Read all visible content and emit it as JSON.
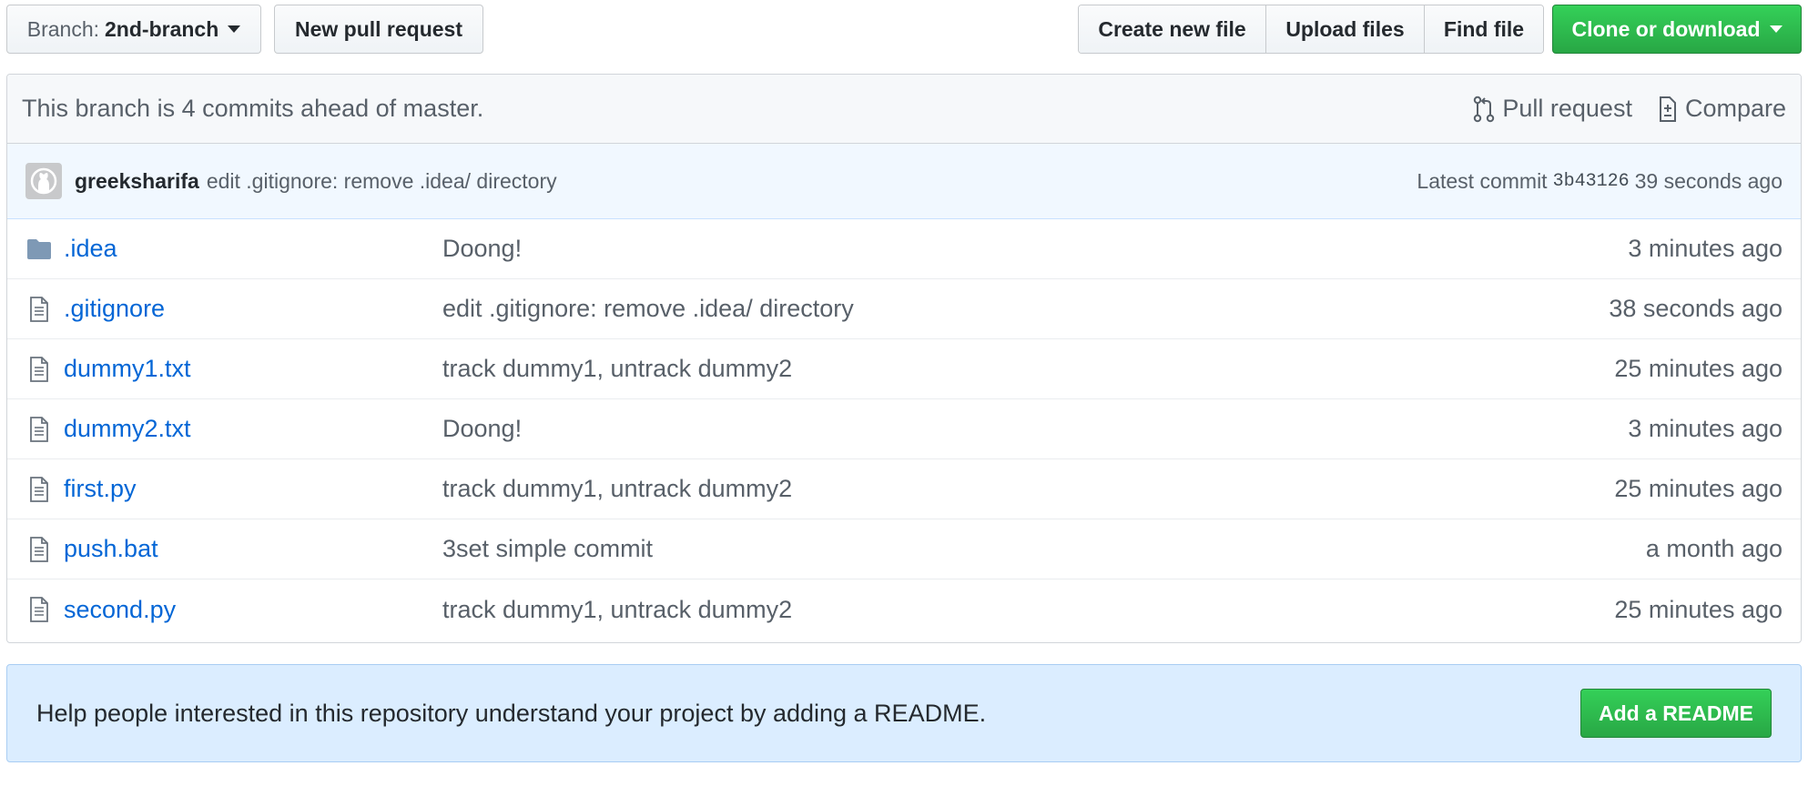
{
  "toolbar": {
    "branch_prefix": "Branch:",
    "branch_name": "2nd-branch",
    "new_pull_request": "New pull request",
    "create_new_file": "Create new file",
    "upload_files": "Upload files",
    "find_file": "Find file",
    "clone_or_download": "Clone or download"
  },
  "branch_info": {
    "text": "This branch is 4 commits ahead of master.",
    "pull_request": "Pull request",
    "compare": "Compare"
  },
  "latest_commit": {
    "author": "greeksharifa",
    "message": "edit .gitignore: remove .idea/ directory",
    "label": "Latest commit",
    "sha": "3b43126",
    "age": "39 seconds ago"
  },
  "files": [
    {
      "name": ".idea",
      "type": "folder",
      "message": "Doong!",
      "age": "3 minutes ago"
    },
    {
      "name": ".gitignore",
      "type": "file",
      "message": "edit .gitignore: remove .idea/ directory",
      "age": "38 seconds ago"
    },
    {
      "name": "dummy1.txt",
      "type": "file",
      "message": "track dummy1, untrack dummy2",
      "age": "25 minutes ago"
    },
    {
      "name": "dummy2.txt",
      "type": "file",
      "message": "Doong!",
      "age": "3 minutes ago"
    },
    {
      "name": "first.py",
      "type": "file",
      "message": "track dummy1, untrack dummy2",
      "age": "25 minutes ago"
    },
    {
      "name": "push.bat",
      "type": "file",
      "message": "3set simple commit",
      "age": "a month ago"
    },
    {
      "name": "second.py",
      "type": "file",
      "message": "track dummy1, untrack dummy2",
      "age": "25 minutes ago"
    }
  ],
  "readme_prompt": {
    "text": "Help people interested in this repository understand your project by adding a README.",
    "button": "Add a README"
  },
  "colors": {
    "link": "#0366d6",
    "green": "#28a745",
    "info_bg": "#dbedff",
    "commit_bg": "#f1f8ff"
  },
  "icons": {
    "folder": "folder-icon",
    "file": "file-icon",
    "pull_request": "git-pull-request-icon",
    "compare": "diff-icon",
    "avatar": "github-avatar-icon",
    "caret": "caret-down-icon"
  }
}
